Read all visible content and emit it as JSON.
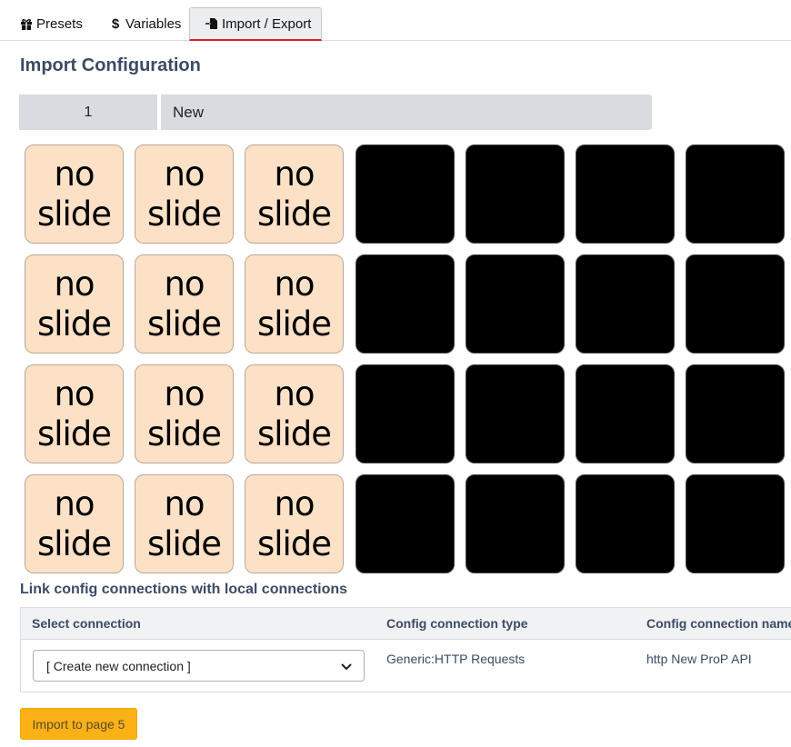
{
  "tabs": [
    {
      "label": "Presets",
      "icon": "gift-icon"
    },
    {
      "label": "Variables",
      "icon": "dollar-icon"
    },
    {
      "label": "Import / Export",
      "icon": "import-icon",
      "active": true
    }
  ],
  "title": "Import Configuration",
  "page": {
    "number": "1",
    "name": "New"
  },
  "grid": {
    "rows": 4,
    "cols": 7,
    "slide_cols": 3,
    "slide_text_line1": "no",
    "slide_text_line2": "slide",
    "slide_color": "#fde1c6",
    "empty_color": "#000000"
  },
  "connections": {
    "title": "Link config connections with local connections",
    "headers": [
      "Select connection",
      "Config connection type",
      "Config connection name"
    ],
    "row": {
      "selected": "[ Create new connection ]",
      "type": "Generic:HTTP Requests",
      "name": "http New ProP API"
    }
  },
  "import_button": "Import to page 5",
  "colors": {
    "accent": "#d9202f",
    "warning": "#f9b115",
    "heading": "#3c4b64"
  }
}
